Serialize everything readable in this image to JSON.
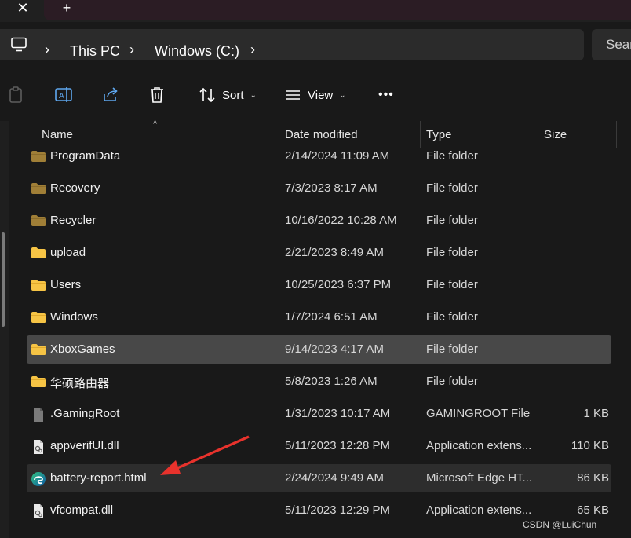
{
  "titlebar": {
    "close_glyph": "✕",
    "new_tab_glyph": "+"
  },
  "breadcrumb": {
    "root_icon": "computer-icon",
    "items": [
      "This PC",
      "Windows (C:)"
    ],
    "separator": "›"
  },
  "search": {
    "placeholder": "Sear"
  },
  "toolbar": {
    "sort_label": "Sort",
    "view_label": "View",
    "more_glyph": "•••",
    "caret": "⌄"
  },
  "columns": {
    "name": "Name",
    "date": "Date modified",
    "type": "Type",
    "size": "Size",
    "sort_indicator": "^"
  },
  "rows": [
    {
      "name": "ProgramData",
      "date": "2/14/2024 11:09 AM",
      "type": "File folder",
      "size": "",
      "icon": "folder-dim-icon"
    },
    {
      "name": "Recovery",
      "date": "7/3/2023 8:17 AM",
      "type": "File folder",
      "size": "",
      "icon": "folder-dim-icon"
    },
    {
      "name": "Recycler",
      "date": "10/16/2022 10:28 AM",
      "type": "File folder",
      "size": "",
      "icon": "folder-dim-icon"
    },
    {
      "name": "upload",
      "date": "2/21/2023 8:49 AM",
      "type": "File folder",
      "size": "",
      "icon": "folder-icon"
    },
    {
      "name": "Users",
      "date": "10/25/2023 6:37 PM",
      "type": "File folder",
      "size": "",
      "icon": "folder-icon"
    },
    {
      "name": "Windows",
      "date": "1/7/2024 6:51 AM",
      "type": "File folder",
      "size": "",
      "icon": "folder-icon"
    },
    {
      "name": "XboxGames",
      "date": "9/14/2023 4:17 AM",
      "type": "File folder",
      "size": "",
      "icon": "folder-icon"
    },
    {
      "name": "华硕路由器",
      "date": "5/8/2023 1:26 AM",
      "type": "File folder",
      "size": "",
      "icon": "folder-icon"
    },
    {
      "name": ".GamingRoot",
      "date": "1/31/2023 10:17 AM",
      "type": "GAMINGROOT File",
      "size": "1 KB",
      "icon": "file-icon"
    },
    {
      "name": "appverifUI.dll",
      "date": "5/11/2023 12:28 PM",
      "type": "Application extens...",
      "size": "110 KB",
      "icon": "dll-file-icon"
    },
    {
      "name": "battery-report.html",
      "date": "2/24/2024 9:49 AM",
      "type": "Microsoft Edge HT...",
      "size": "86 KB",
      "icon": "edge-icon"
    },
    {
      "name": "vfcompat.dll",
      "date": "5/11/2023 12:29 PM",
      "type": "Application extens...",
      "size": "65 KB",
      "icon": "dll-file-icon"
    }
  ],
  "colors": {
    "background": "#191919",
    "selected_row": "#484848",
    "folder": "#f6c445",
    "folder_dim": "#a07f37",
    "annotation_arrow": "#e8322c"
  },
  "watermark": "CSDN @LuiChun"
}
